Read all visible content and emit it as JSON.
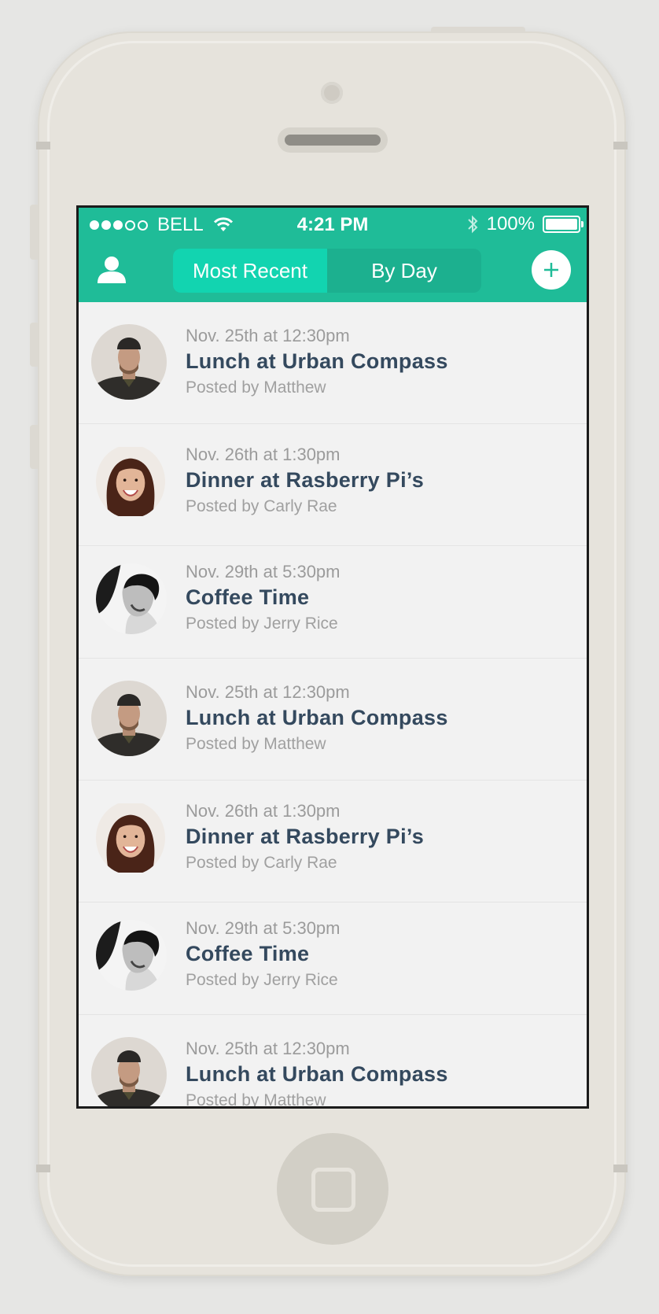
{
  "status_bar": {
    "carrier": "BELL",
    "time": "4:21 PM",
    "battery_percent": "100%",
    "signal_filled": 3,
    "signal_total": 5
  },
  "nav": {
    "tabs": [
      {
        "label": "Most Recent",
        "active": true
      },
      {
        "label": "By Day",
        "active": false
      }
    ]
  },
  "feed": [
    {
      "date": "Nov. 25th at 12:30pm",
      "title": "Lunch at Urban Compass",
      "posted_by": "Posted by Matthew",
      "avatar": "man-beanie"
    },
    {
      "date": "Nov. 26th at 1:30pm",
      "title": "Dinner at Rasberry Pi’s",
      "posted_by": "Posted by Carly Rae",
      "avatar": "woman-smiling"
    },
    {
      "date": "Nov. 29th at 5:30pm",
      "title": "Coffee Time",
      "posted_by": "Posted by Jerry Rice",
      "avatar": "man-profile-bw"
    },
    {
      "date": "Nov. 25th at 12:30pm",
      "title": "Lunch at Urban Compass",
      "posted_by": "Posted by Matthew",
      "avatar": "man-beanie"
    },
    {
      "date": "Nov. 26th at 1:30pm",
      "title": "Dinner at Rasberry Pi’s",
      "posted_by": "Posted by Carly Rae",
      "avatar": "woman-smiling"
    },
    {
      "date": "Nov. 29th at 5:30pm",
      "title": "Coffee Time",
      "posted_by": "Posted by Jerry Rice",
      "avatar": "man-profile-bw"
    },
    {
      "date": "Nov. 25th at 12:30pm",
      "title": "Lunch at Urban Compass",
      "posted_by": "Posted by Matthew",
      "avatar": "man-beanie"
    }
  ],
  "colors": {
    "accent": "#1fbc98",
    "active_segment": "#12d4b0",
    "title_text": "#34495e",
    "meta_text": "#9b9b9b"
  }
}
